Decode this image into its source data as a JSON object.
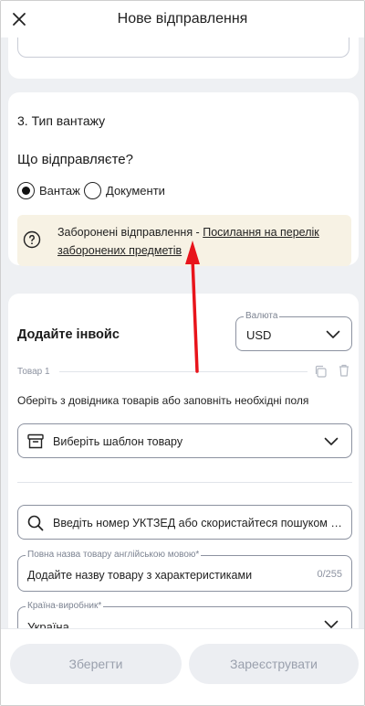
{
  "header": {
    "title": "Нове відправлення"
  },
  "cargo_section": {
    "title": "3. Тип вантажу",
    "question": "Що відправляєте?",
    "options": [
      {
        "label": "Вантаж",
        "selected": true
      },
      {
        "label": "Документи",
        "selected": false
      }
    ],
    "notice": {
      "text": "Заборонені відправлення - ",
      "link": "Посилання на перелік заборонених предметів"
    }
  },
  "invoice": {
    "title": "Додайте інвойс",
    "currency": {
      "label": "Валюта",
      "value": "USD"
    },
    "item_label": "Товар 1",
    "hint": "Оберіть з довідника товарів або заповніть необхідні поля",
    "template_select": "Виберіть шаблон товару",
    "search_placeholder": "Введіть номер УКТЗЕД або скористайтеся пошуком код...",
    "name_field": {
      "label": "Повна назва товару англійською мовою*",
      "placeholder": "Додайте назву товару з характеристиками",
      "counter": "0/255"
    },
    "country_field": {
      "label": "Країна-виробник*",
      "value": "Україна"
    }
  },
  "footer": {
    "save_label": "Зберегти",
    "register_label": "Зареєструвати"
  },
  "colors": {
    "accent_arrow": "#e8141b",
    "notice_bg": "#f7f2e4",
    "disabled_btn": "#eceef2"
  },
  "icons": [
    "close-icon",
    "info-icon",
    "chevron-down-icon",
    "copy-icon",
    "trash-icon",
    "box-icon",
    "search-icon"
  ]
}
